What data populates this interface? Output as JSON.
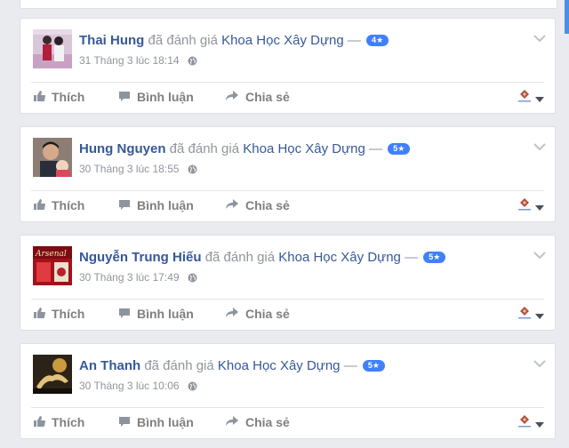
{
  "feed": {
    "posts": [
      {
        "name": "Thai Hung",
        "verb": "đã đánh giá",
        "page": "Khoa Học Xây Dựng",
        "dash": "—",
        "rating": "4",
        "time": "31 Tháng 3 lúc 18:14",
        "avatar_icon": "couple-photo"
      },
      {
        "name": "Hung Nguyen",
        "verb": "đã đánh giá",
        "page": "Khoa Học Xây Dựng",
        "dash": "—",
        "rating": "5",
        "time": "30 Tháng 3 lúc 18:55",
        "avatar_icon": "man-with-baby-photo"
      },
      {
        "name": "Nguyễn Trung Hiếu",
        "verb": "đã đánh giá",
        "page": "Khoa Học Xây Dựng",
        "dash": "—",
        "rating": "5",
        "time": "30 Tháng 3 lúc 17:49",
        "avatar_icon": "arsenal-photo"
      },
      {
        "name": "An Thanh",
        "verb": "đã đánh giá",
        "page": "Khoa Học Xây Dựng",
        "dash": "—",
        "rating": "5",
        "time": "30 Tháng 3 lúc 10:06",
        "avatar_icon": "dark-eagle-photo"
      }
    ],
    "actions": {
      "like": "Thích",
      "comment": "Bình luận",
      "share": "Chia sẻ"
    },
    "star": "★"
  }
}
